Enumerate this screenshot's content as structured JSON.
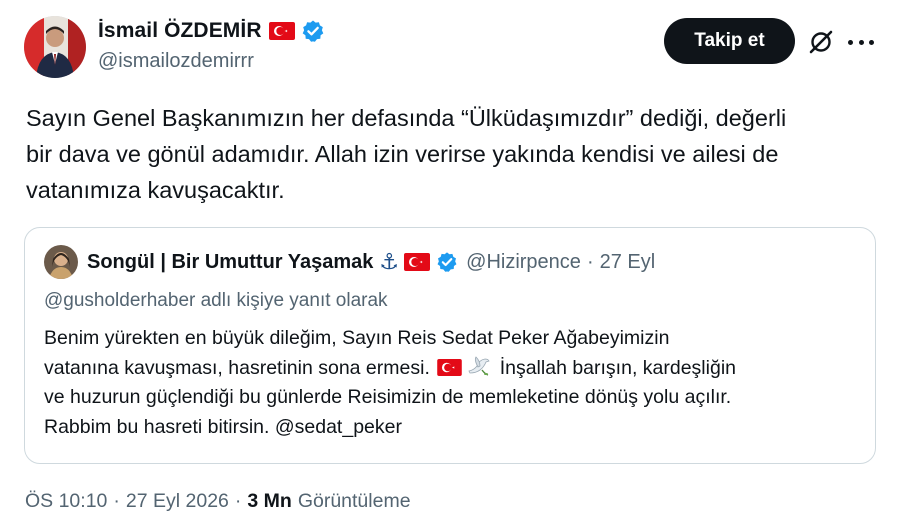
{
  "author": {
    "name": "İsmail ÖZDEMİR",
    "handle": "@ismailozdemirrr",
    "flag_icon": "turkey-flag-icon",
    "verified_icon": "verified-badge-icon"
  },
  "actions": {
    "follow_label": "Takip et",
    "grok_icon": "grok-icon",
    "more_icon": "more-options-icon"
  },
  "tweet": {
    "lines": [
      "Sayın Genel Başkanımızın her defasında “Ülküdaşımızdır” dediği, değerli",
      "bir dava ve gönül adamıdır. Allah izin verirse yakında kendisi ve ailesi de",
      "vatanımıza kavuşacaktır."
    ]
  },
  "quote": {
    "name": "Songül | Bir Umuttur Yaşamak",
    "anchor_emoji": "⚓",
    "handle": "@Hizirpence",
    "separator": "·",
    "date": "27 Eyl",
    "reply_to": "@gusholderhaber adlı kişiye yanıt olarak",
    "text": {
      "line1": "Benim yürekten en büyük dileğim, Sayın Reis Sedat Peker Ağabeyimizin",
      "line2_before": "vatanına kavuşması, hasretinin sona ermesi.",
      "line2_after": "İnşallah barışın, kardeşliğin",
      "line3": "ve huzurun güçlendiği bu günlerde Reisimizin de memleketine dönüş yolu açılır.",
      "line4": "Rabbim bu hasreti bitirsin.  @sedat_peker"
    }
  },
  "meta": {
    "time": "ÖS 10:10",
    "sep1": "·",
    "date": "27 Eyl 2026",
    "sep2": "·",
    "views_count": "3 Mn",
    "views_label": "Görüntüleme"
  },
  "colors": {
    "text_primary": "#0f1419",
    "text_secondary": "#536471",
    "border": "#cfd9de",
    "verified_blue": "#1d9bf0",
    "flag_red": "#e30a17"
  }
}
